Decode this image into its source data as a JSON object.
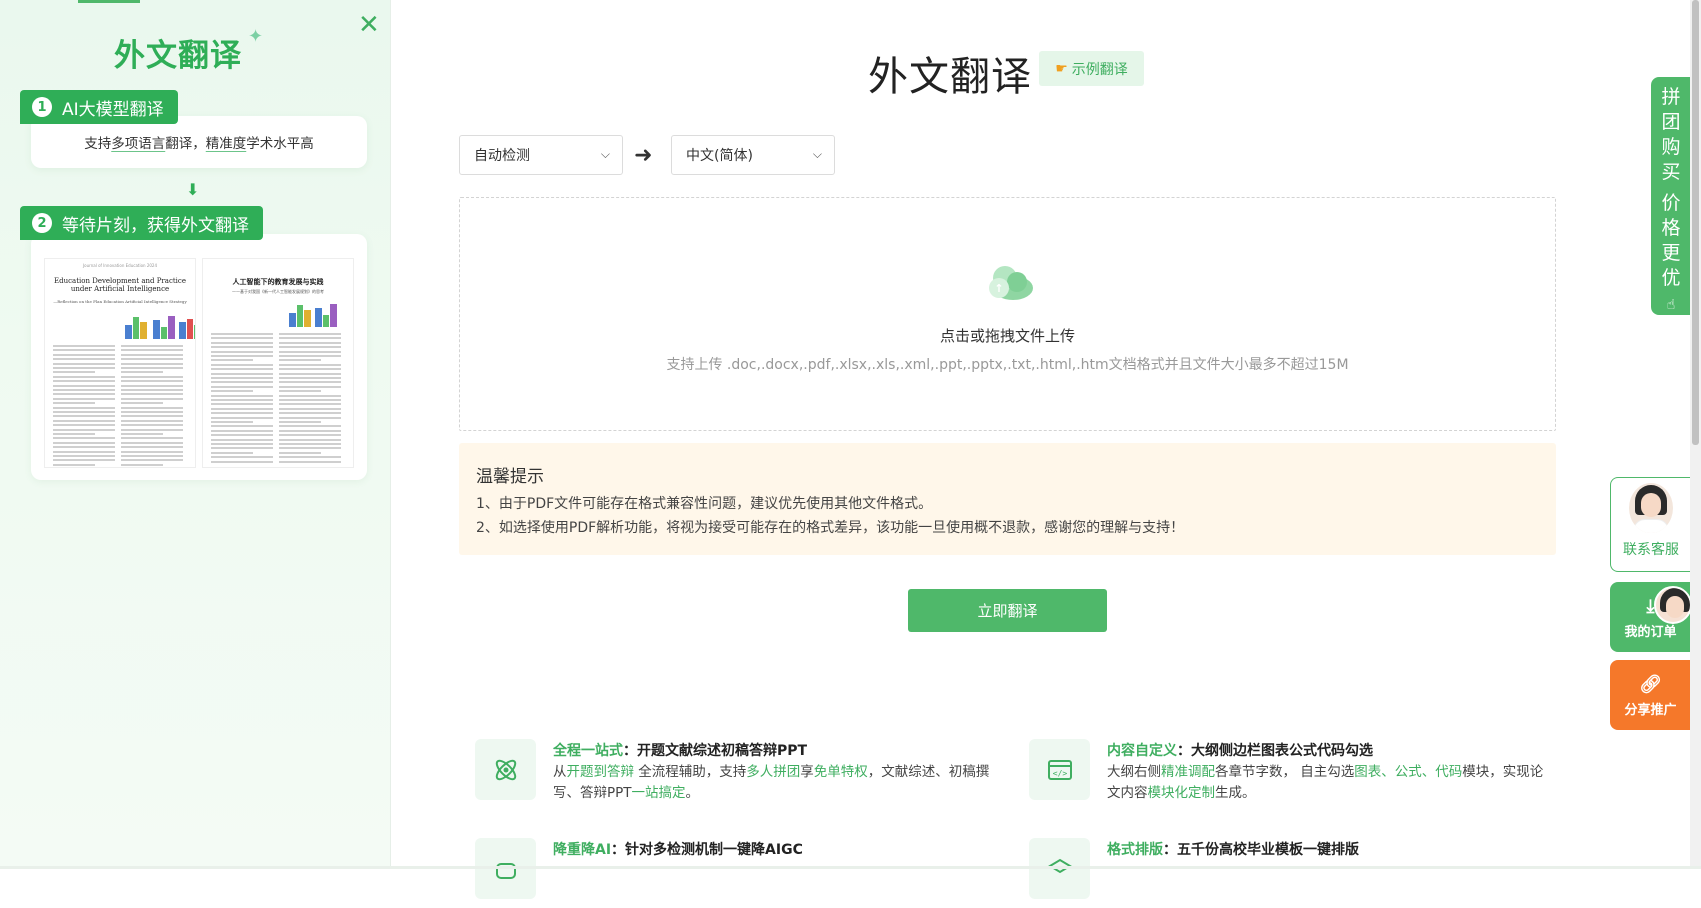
{
  "left_panel": {
    "brand": "外文翻译",
    "step1": {
      "num": "1",
      "label": "AI大模型翻译",
      "desc_a": "支持",
      "desc_b": "多项语言",
      "desc_c": "翻译，",
      "desc_d": "精准度",
      "desc_e": "学术水平高"
    },
    "step2": {
      "num": "2",
      "label": "等待片刻，获得外文翻译"
    },
    "preview": {
      "en_header": "Journal of Innovation Education 2024",
      "en_title": "Education Development and Practice under Artificial Intelligence",
      "en_subtitle": "—Reflection on the Plan Education Artificial Intelligence Strategy",
      "cn_title": "人工智能下的教育发展与实践",
      "cn_subtitle": "——基于对我国《新一代人工智能发展规划》的思考"
    }
  },
  "main": {
    "title": "外文翻译",
    "example_button": "示例翻译",
    "source_lang": "自动检测",
    "target_lang": "中文(简体)",
    "dropzone_title": "点击或拖拽文件上传",
    "dropzone_hint": "支持上传 .doc,.docx,.pdf,.xlsx,.xls,.xml,.ppt,.pptx,.txt,.html,.htm文档格式并且文件大小最多不超过15M",
    "notice": {
      "title": "温馨提示",
      "line1": "1、由于PDF文件可能存在格式兼容性问题，建议优先使用其他文件格式。",
      "line2": "2、如选择使用PDF解析功能，将视为接受可能存在的格式差异，该功能一旦使用概不退款，感谢您的理解与支持！"
    },
    "translate_button": "立即翻译"
  },
  "features": [
    {
      "title_green": "全程一站式",
      "title_rest": "：开题文献综述初稿答辩PPT",
      "desc": [
        {
          "t": "从",
          "g": false
        },
        {
          "t": "开题到答辩",
          "g": true
        },
        {
          "t": " 全流程辅助，支持",
          "g": false
        },
        {
          "t": "多人拼团",
          "g": true
        },
        {
          "t": "享",
          "g": false
        },
        {
          "t": "免单特权",
          "g": true
        },
        {
          "t": "，文献综述、初稿撰写、答辩PPT",
          "g": false
        },
        {
          "t": "一站搞定",
          "g": true
        },
        {
          "t": "。",
          "g": false
        }
      ]
    },
    {
      "title_green": "内容自定义",
      "title_rest": "：大纲侧边栏图表公式代码勾选",
      "desc": [
        {
          "t": "大纲右侧",
          "g": false
        },
        {
          "t": "精准调配",
          "g": true
        },
        {
          "t": "各章节字数， 自主勾选",
          "g": false
        },
        {
          "t": "图表、公式、代码",
          "g": true
        },
        {
          "t": "模块，实现论文内容",
          "g": false
        },
        {
          "t": "模块化定制",
          "g": true
        },
        {
          "t": "生成。",
          "g": false
        }
      ]
    },
    {
      "title_green": "降重降AI",
      "title_rest": "：针对多检测机制一键降AIGC",
      "desc": []
    },
    {
      "title_green": "格式排版",
      "title_rest": "：五千份高校毕业模板一键排版",
      "desc": []
    }
  ],
  "side": {
    "group_buy": "拼团购买价格更优",
    "service": "联系客服",
    "orders": "我的订单",
    "share": "分享推广"
  },
  "colors": {
    "primary": "#4fb86a",
    "brand_text": "#2fae57",
    "notice_bg": "#fff7ea",
    "share": "#f5782a"
  }
}
